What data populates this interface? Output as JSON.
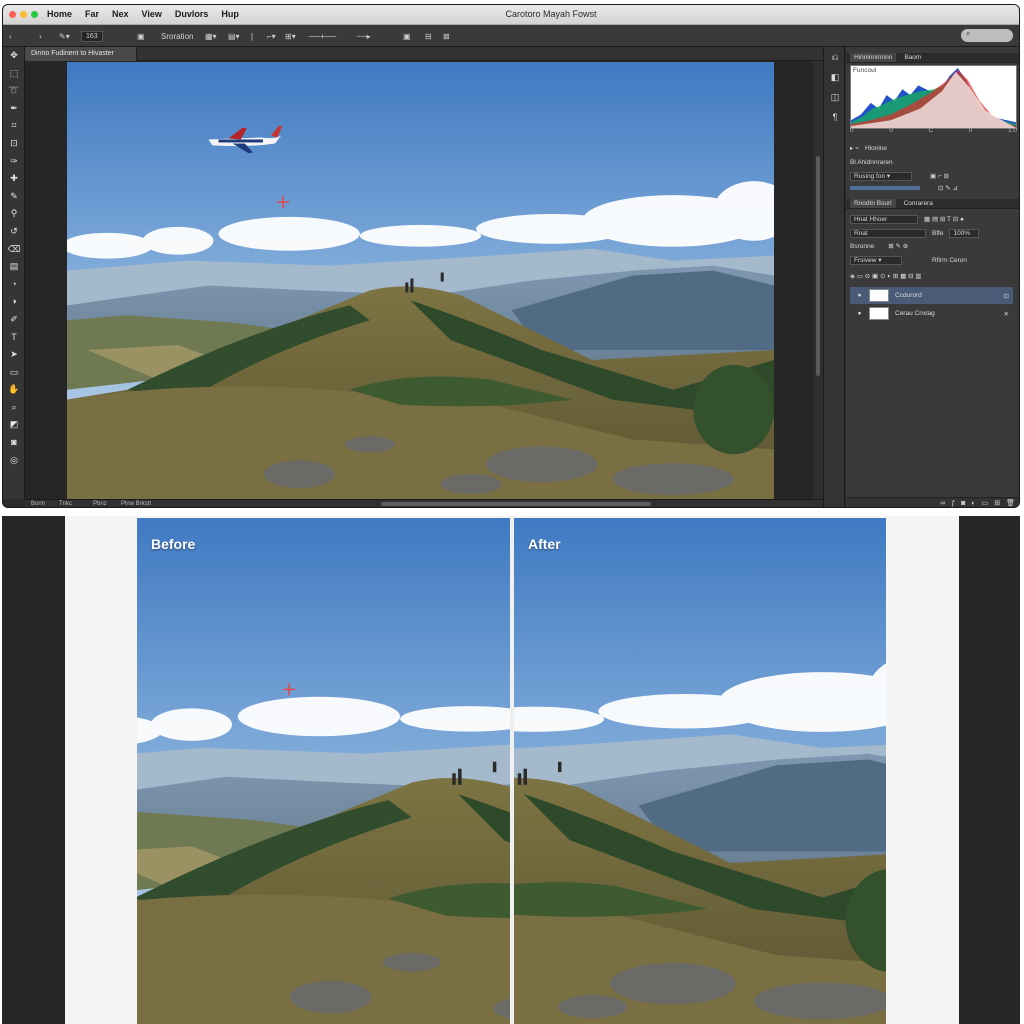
{
  "window": {
    "title": "Carotoro Mayah Fowst",
    "menu": [
      "Home",
      "Far",
      "Nex",
      "View",
      "Duvlors",
      "Hup"
    ]
  },
  "options_bar": {
    "size_value": "163",
    "mode_label": "Sroration"
  },
  "document_tab": {
    "label": "Dinno Fudinent to Hivaster"
  },
  "status_bar": {
    "items": [
      "Bonn",
      "Tnkc",
      "Pbnz",
      "Plnw Brkstt"
    ]
  },
  "histogram_panel": {
    "tabs": [
      "Hinninnmnnn",
      "Baom"
    ],
    "label": "Funcoul",
    "channel_label": "Hlonine",
    "sub_label": "Bl Ahidnnraren",
    "axis_ticks": [
      "0",
      "0",
      "C",
      "0",
      "1:0"
    ]
  },
  "layers_panel": {
    "tabs": [
      "Rnodtn Bsurl",
      "Conrarera"
    ],
    "kind_field": "Hnat Hhoer",
    "blend_mode": "Rnat",
    "opacity_label": "Bffe",
    "lock_label": "Bsronne",
    "fill_label": "Rfirm Ceron",
    "layers": [
      {
        "name": "Ccdurord",
        "selected": true
      },
      {
        "name": "Cerau Cnxlag",
        "selected": false
      }
    ]
  },
  "comparison": {
    "before_label": "Before",
    "after_label": "After"
  },
  "colors": {
    "accent_selected": "#4a5b77",
    "panel_bg": "#3a3a3a",
    "canvas_bg": "#262626"
  }
}
